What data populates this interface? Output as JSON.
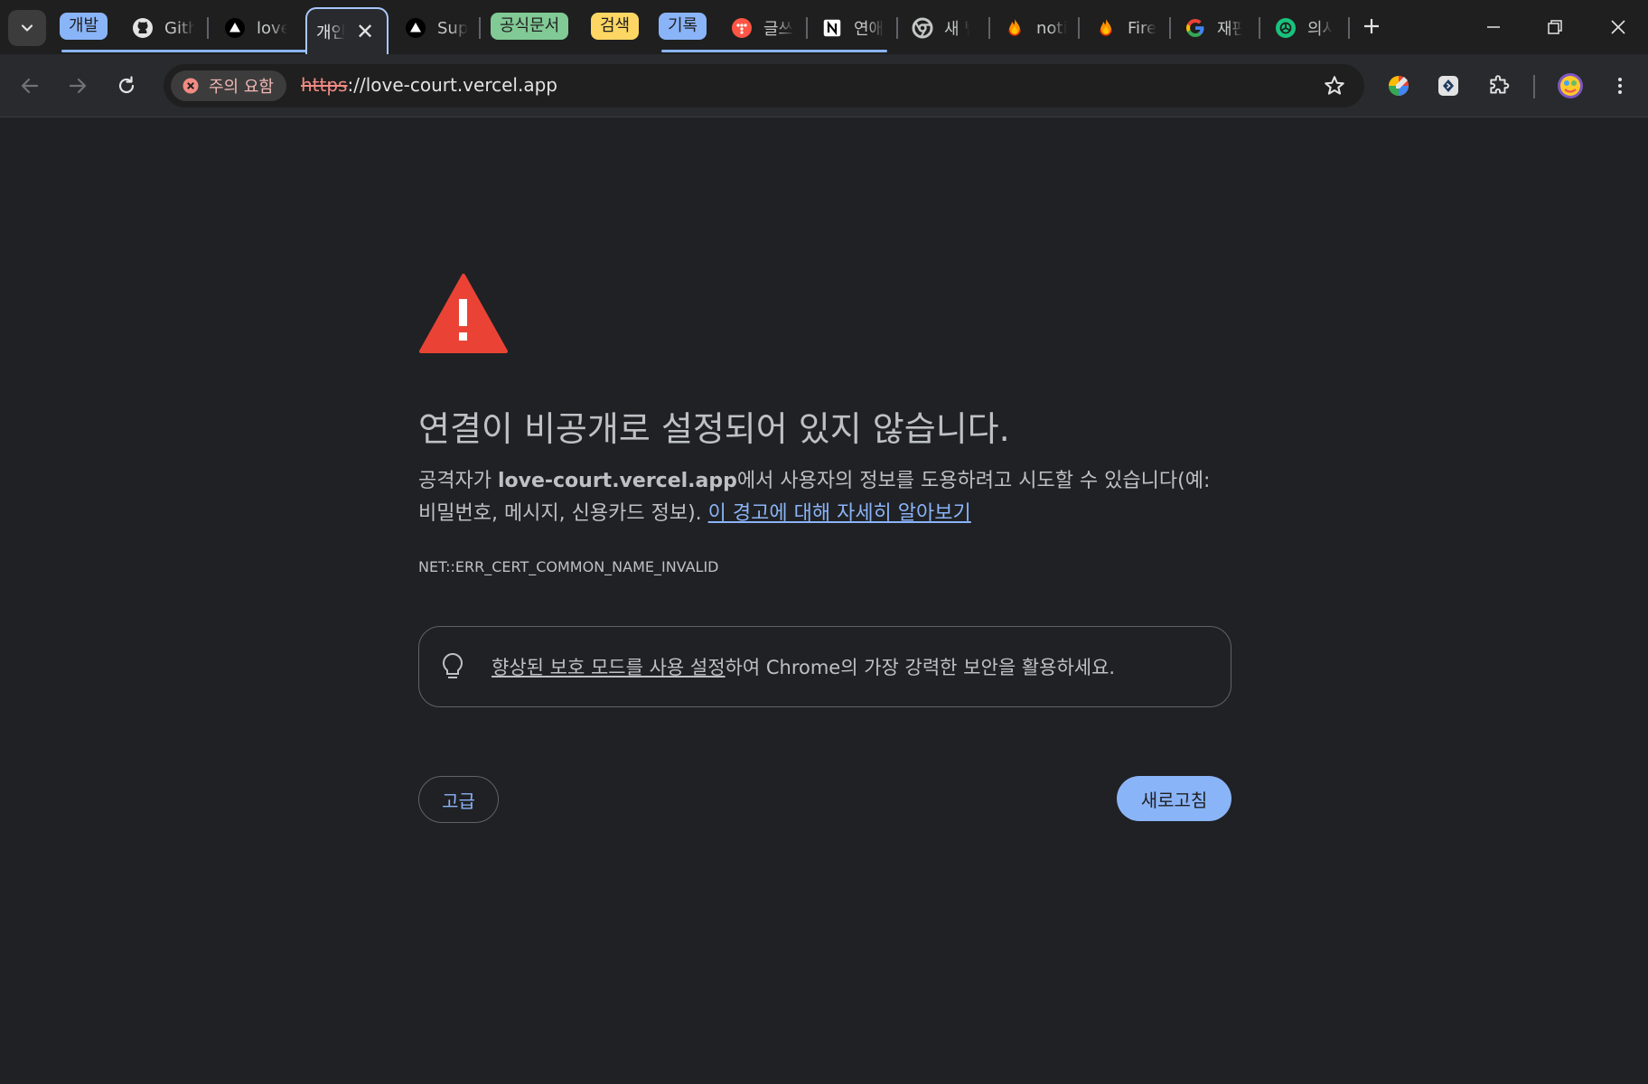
{
  "tab_strip": {
    "groups": [
      {
        "label": "개발",
        "color": "#8ab4f8"
      },
      {
        "label": "공식문서",
        "color": "#81c995"
      },
      {
        "label": "검색",
        "color": "#fdd663"
      },
      {
        "label": "기록",
        "color": "#8ab4f8"
      }
    ],
    "tabs": [
      {
        "title": "Github",
        "icon": "github-icon"
      },
      {
        "title": "love",
        "icon": "vercel-icon"
      },
      {
        "title": "개인정보 오류",
        "icon": "none",
        "active": true
      },
      {
        "title": "Supabase",
        "icon": "vercel-icon"
      },
      {
        "title": "글쓰기",
        "icon": "tistory-icon"
      },
      {
        "title": "연애",
        "icon": "notion-icon"
      },
      {
        "title": "새 탭",
        "icon": "chrome-icon"
      },
      {
        "title": "notification",
        "icon": "firebase-icon"
      },
      {
        "title": "Firebase",
        "icon": "firebase-icon"
      },
      {
        "title": "재판",
        "icon": "google-icon"
      },
      {
        "title": "의사",
        "icon": "chatgpt-icon"
      }
    ]
  },
  "toolbar": {
    "security_chip": "주의 요함",
    "url_scheme": "https",
    "url_rest": "://love-court.vercel.app"
  },
  "page": {
    "heading": "연결이 비공개로 설정되어 있지 않습니다.",
    "desc_pre": "공격자가 ",
    "desc_host": "love-court.vercel.app",
    "desc_mid": "에서 사용자의 정보를 도용하려고 시도할 수 있습니다(예: 비밀번호, 메시지, 신용카드 정보). ",
    "desc_link": "이 경고에 대해 자세히 알아보기",
    "error_code": "NET::ERR_CERT_COMMON_NAME_INVALID",
    "promo_link": "향상된 보호 모드를 사용 설정",
    "promo_rest": "하여 Chrome의 가장 강력한 보안을 활용하세요.",
    "advanced_label": "고급",
    "reload_label": "새로고침"
  },
  "colors": {
    "accent": "#8ab4f8",
    "warning": "#ea4335",
    "background": "#202124"
  }
}
